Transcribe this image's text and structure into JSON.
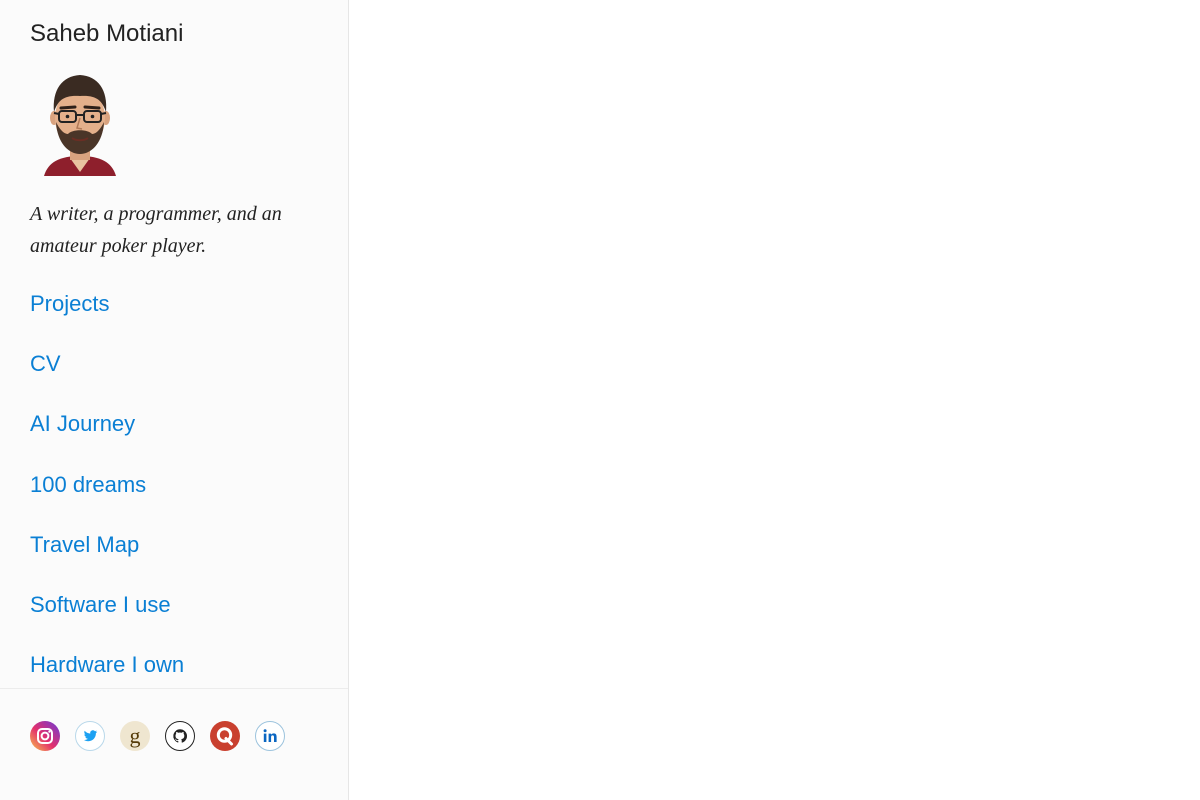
{
  "site": {
    "title": "Saheb Motiani",
    "tagline": "A writer, a programmer, and an amateur poker player."
  },
  "nav": {
    "items": [
      {
        "label": "Projects"
      },
      {
        "label": "CV"
      },
      {
        "label": "AI Journey"
      },
      {
        "label": "100 dreams"
      },
      {
        "label": "Travel Map"
      },
      {
        "label": "Software I use"
      },
      {
        "label": "Hardware I own"
      }
    ]
  },
  "social": {
    "icons": [
      "instagram-icon",
      "twitter-icon",
      "goodreads-icon",
      "github-icon",
      "quora-icon",
      "linkedin-icon"
    ]
  },
  "colors": {
    "link": "#0a7fd4",
    "text": "#222222",
    "sidebar_bg": "#fbfbfb",
    "border": "#e6e6e6"
  }
}
